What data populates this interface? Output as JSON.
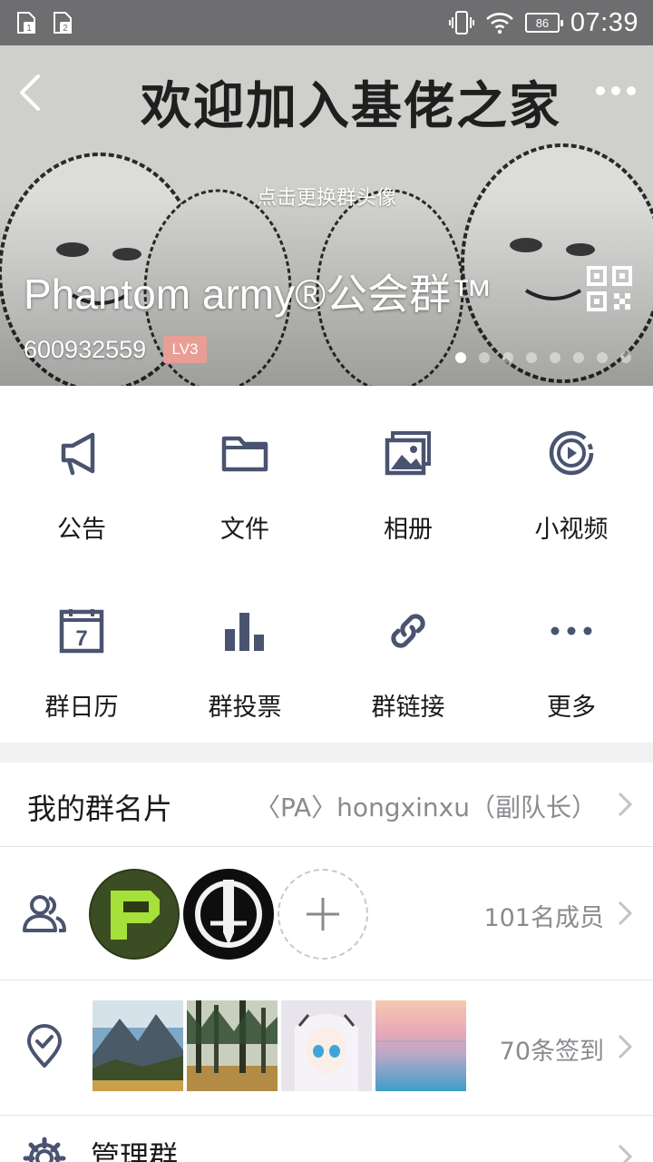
{
  "status_bar": {
    "sim1": "1",
    "sim2": "2",
    "battery": "86",
    "time": "07:39"
  },
  "header": {
    "banner_text": "欢迎加入基佬之家",
    "change_avatar_hint": "点击更换群头像",
    "group_name": "Phantom army®公会群™",
    "group_id": "600932559",
    "level_badge": "LV3",
    "page_count": 8,
    "active_page": 1
  },
  "features": [
    {
      "label": "公告",
      "icon": "megaphone-icon"
    },
    {
      "label": "文件",
      "icon": "folder-icon"
    },
    {
      "label": "相册",
      "icon": "album-icon"
    },
    {
      "label": "小视频",
      "icon": "video-icon"
    },
    {
      "label": "群日历",
      "icon": "calendar-icon"
    },
    {
      "label": "群投票",
      "icon": "poll-icon"
    },
    {
      "label": "群链接",
      "icon": "link-icon"
    },
    {
      "label": "更多",
      "icon": "more-icon"
    }
  ],
  "calendar_day": "7",
  "group_card": {
    "title": "我的群名片",
    "value": "〈PA〉hongxinxu（副队长）"
  },
  "members": {
    "count_text": "101名成员"
  },
  "signin": {
    "count_text": "70条签到"
  },
  "manage": {
    "label": "管理群"
  },
  "colors": {
    "icon": "#4a5470",
    "level_badge": "#e89d95",
    "secondary_text": "#8a8a8f"
  }
}
